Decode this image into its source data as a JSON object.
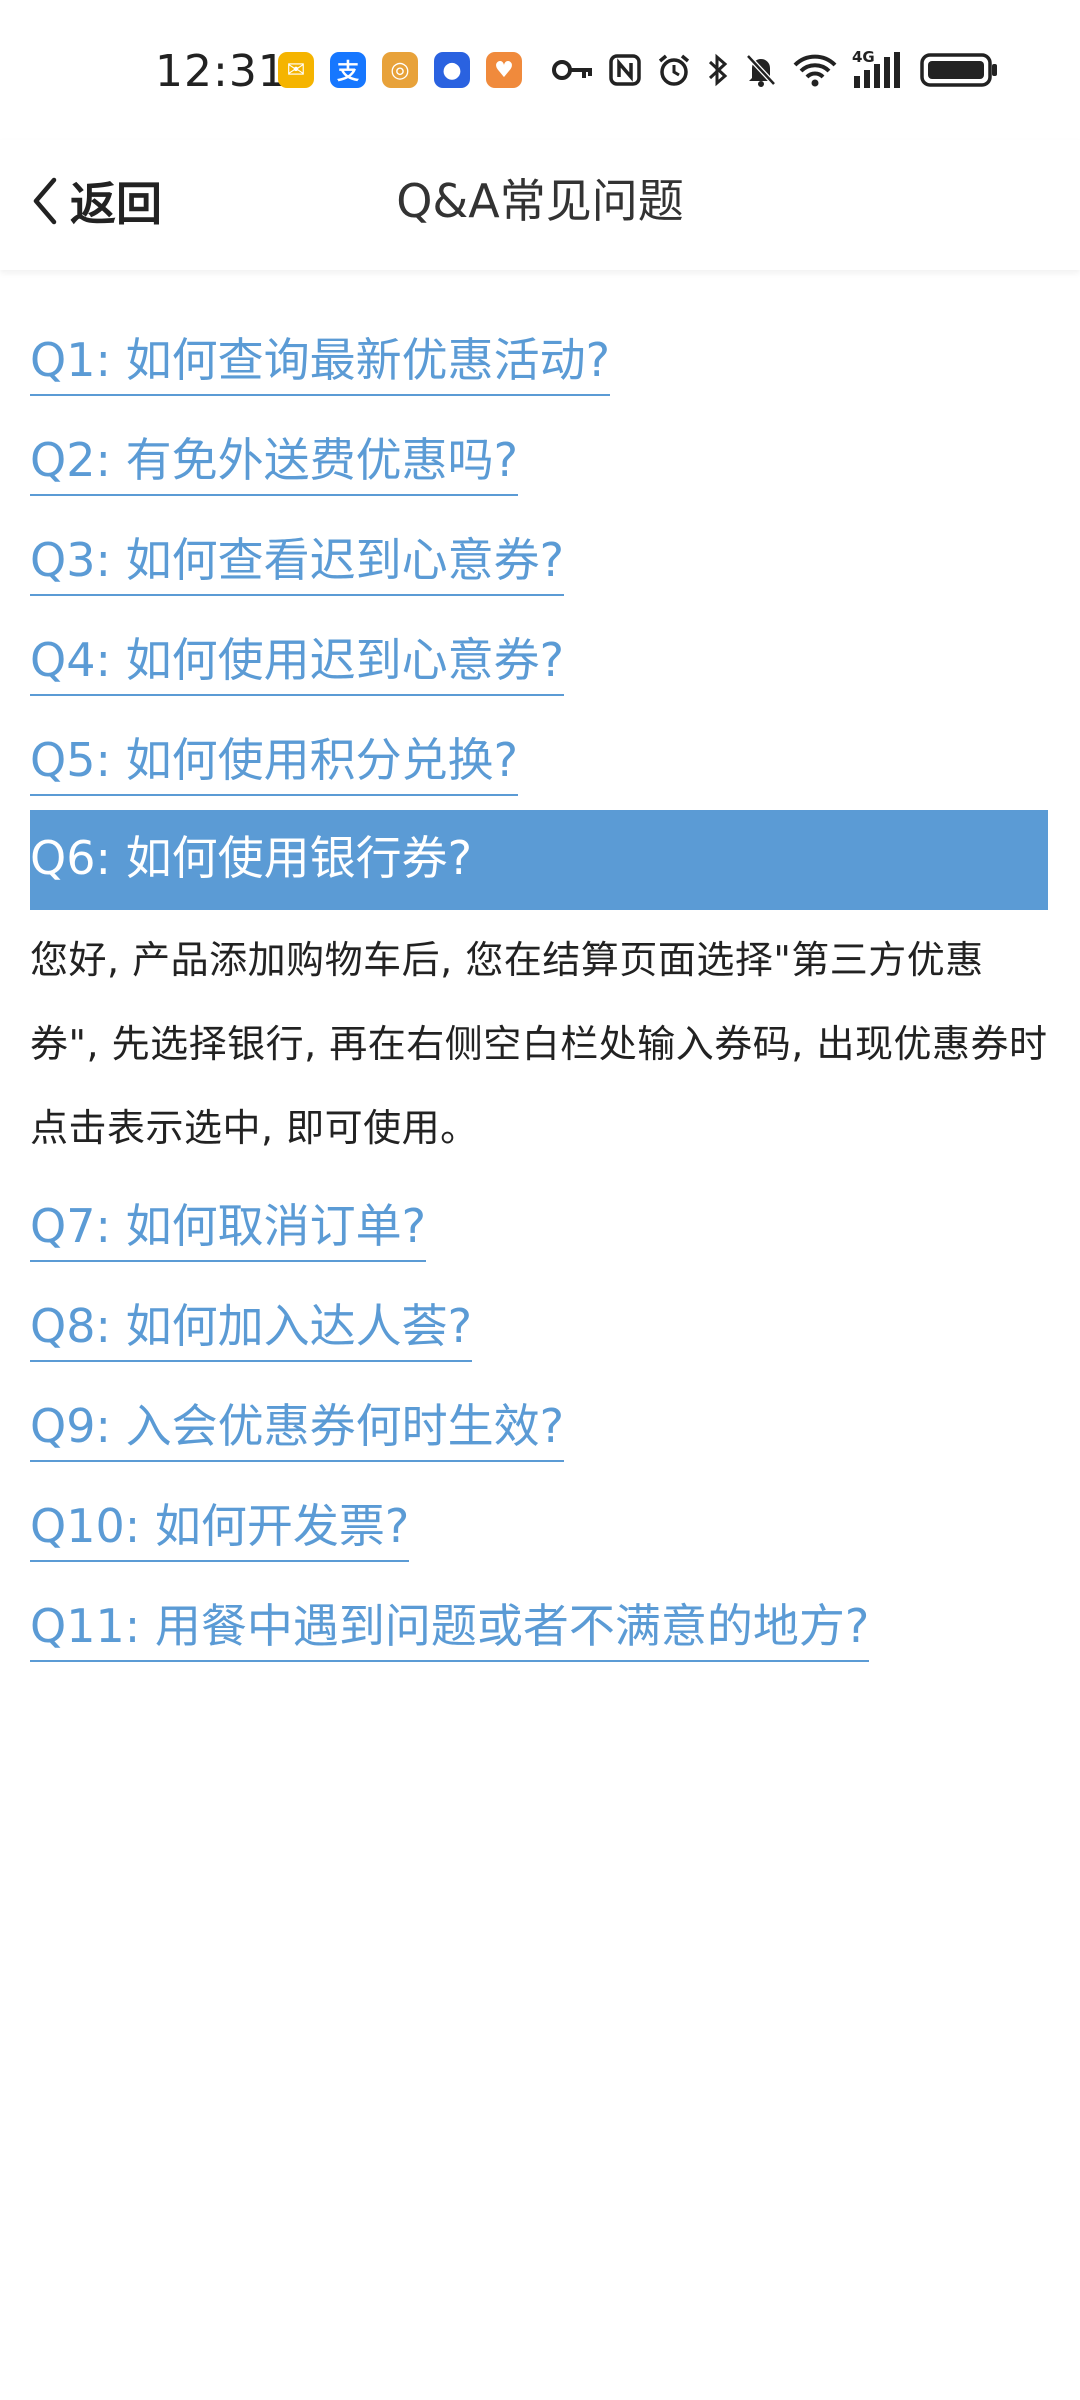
{
  "status_bar": {
    "time": "12:31",
    "notification_icons": [
      {
        "name": "mail-app-icon",
        "glyph": "✉",
        "color": "#f5b400"
      },
      {
        "name": "alipay-app-icon",
        "glyph": "支",
        "color": "#1677ff"
      },
      {
        "name": "target-app-icon",
        "glyph": "◎",
        "color": "#e8a23a"
      },
      {
        "name": "shield-app-icon",
        "glyph": "●",
        "color": "#2a62e0"
      },
      {
        "name": "chat-app-icon",
        "glyph": "♥",
        "color": "#f08a3c"
      }
    ],
    "network": "4G",
    "system_icons": [
      "key-icon",
      "nfc-icon",
      "alarm-icon",
      "bluetooth-icon",
      "mute-icon",
      "wifi-icon",
      "signal-icon",
      "battery-icon"
    ]
  },
  "header": {
    "back_label": "返回",
    "title": "Q&A常见问题"
  },
  "faq": {
    "items": [
      {
        "question": "Q1: 如何查询最新优惠活动?"
      },
      {
        "question": "Q2: 有免外送费优惠吗?"
      },
      {
        "question": "Q3: 如何查看迟到心意券?"
      },
      {
        "question": "Q4: 如何使用迟到心意券?"
      },
      {
        "question": "Q5: 如何使用积分兑换?"
      },
      {
        "question": "Q6: 如何使用银行券?",
        "answer": "您好, 产品添加购物车后, 您在结算页面选择\"第三方优惠券\", 先选择银行, 再在右侧空白栏处输入券码, 出现优惠券时点击表示选中, 即可使用。"
      },
      {
        "question": "Q7: 如何取消订单?"
      },
      {
        "question": "Q8: 如何加入达人荟?"
      },
      {
        "question": "Q9: 入会优惠券何时生效?"
      },
      {
        "question": "Q10: 如何开发票?"
      },
      {
        "question": "Q11: 用餐中遇到问题或者不满意的地方?"
      }
    ]
  },
  "colors": {
    "link": "#5b9bd5",
    "highlight_bg": "#5b9bd5",
    "text": "#222222"
  }
}
